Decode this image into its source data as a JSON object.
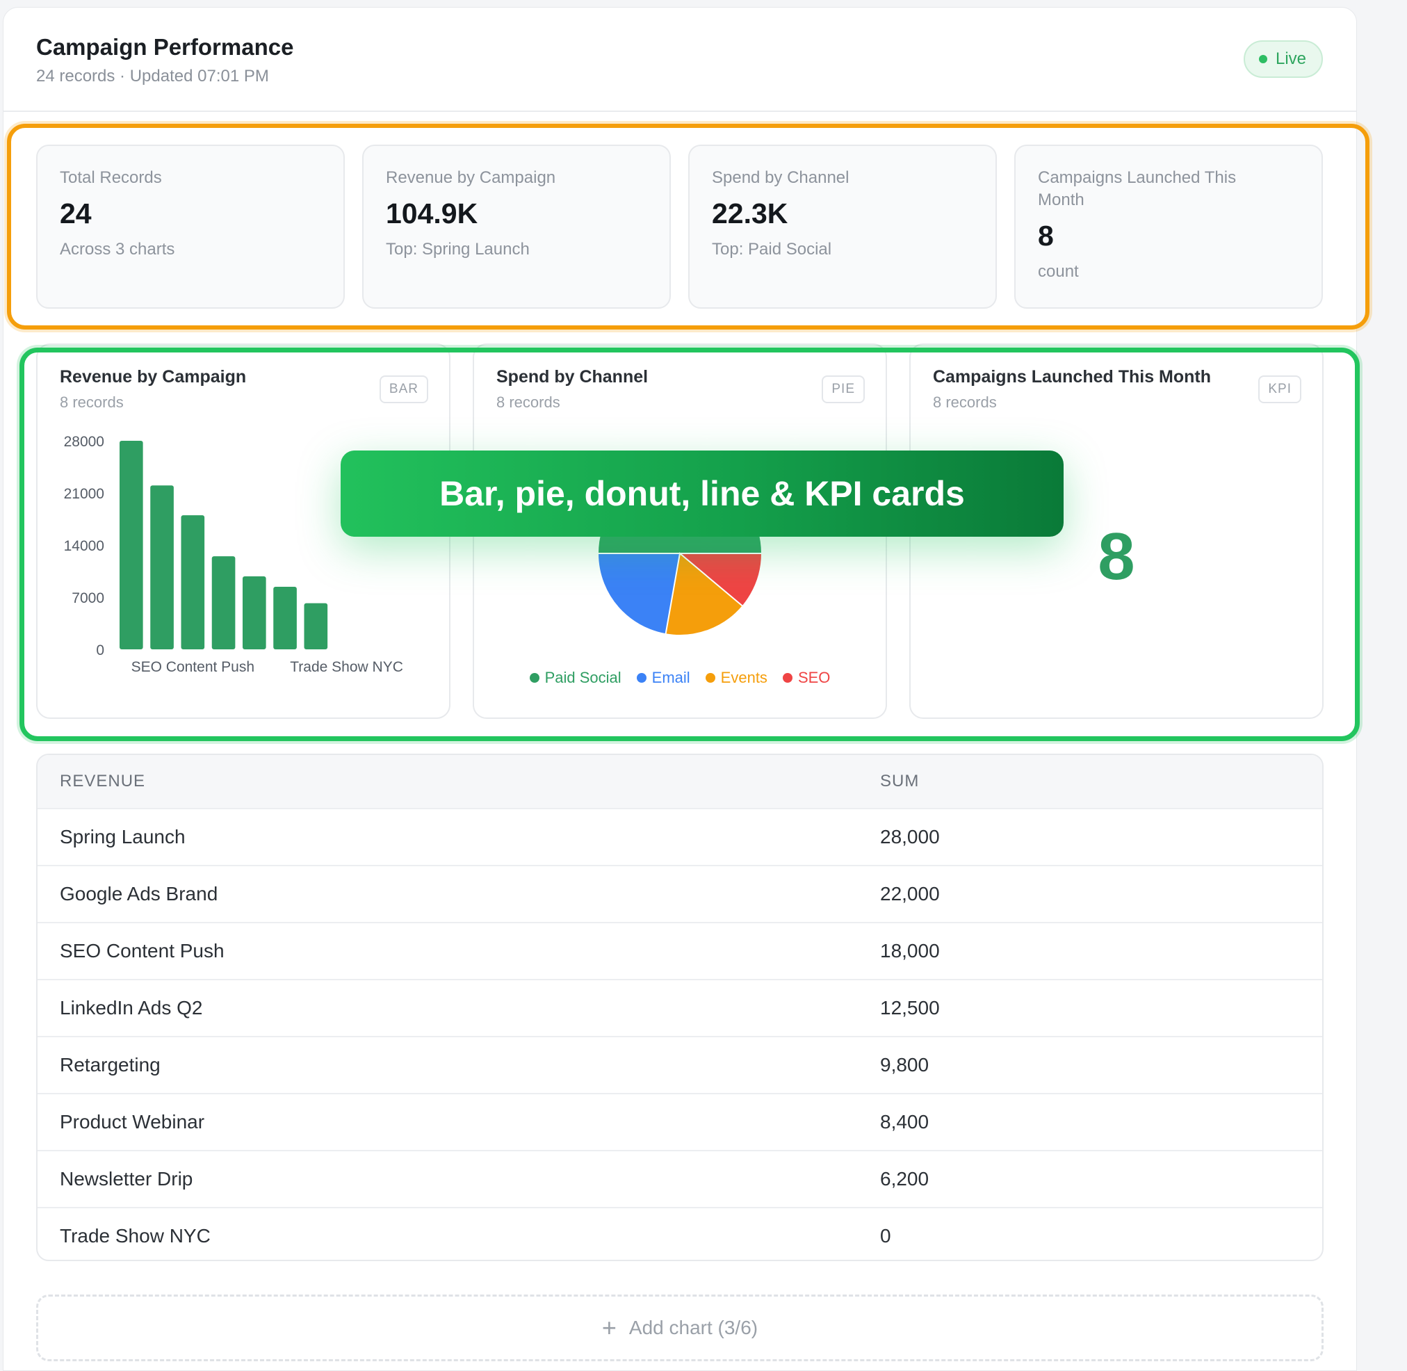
{
  "header": {
    "title": "Campaign Performance",
    "subtitle": "24 records · Updated 07:01 PM",
    "status": "Live"
  },
  "stats": [
    {
      "label": "Total Records",
      "value": "24",
      "sub": "Across 3 charts"
    },
    {
      "label": "Revenue by Campaign",
      "value": "104.9K",
      "sub": "Top: Spring Launch"
    },
    {
      "label": "Spend by Channel",
      "value": "22.3K",
      "sub": "Top: Paid Social"
    },
    {
      "label": "Campaigns Launched This Month",
      "value": "8",
      "sub": "count"
    }
  ],
  "charts": [
    {
      "title": "Revenue by Campaign",
      "records": "8 records",
      "tag": "BAR"
    },
    {
      "title": "Spend by Channel",
      "records": "8 records",
      "tag": "PIE"
    },
    {
      "title": "Campaigns Launched This Month",
      "records": "8 records",
      "tag": "KPI",
      "value": "8"
    }
  ],
  "banner": "Bar, pie, donut, line & KPI cards",
  "chart_data": [
    {
      "type": "bar",
      "title": "Revenue by Campaign",
      "categories": [
        "Spring Launch",
        "Google Ads Brand",
        "SEO Content Push",
        "LinkedIn Ads Q2",
        "Retargeting",
        "Product Webinar",
        "Newsletter Drip",
        "Trade Show NYC"
      ],
      "x_tick_labels": [
        "SEO Content Push",
        "Trade Show NYC"
      ],
      "values": [
        28000,
        22000,
        18000,
        12500,
        9800,
        8400,
        6200,
        0
      ],
      "y_ticks": [
        28000,
        21000,
        14000,
        7000,
        0
      ],
      "ylim": [
        0,
        28000
      ],
      "color": "#2f9e62"
    },
    {
      "type": "pie",
      "title": "Spend by Channel",
      "legend": [
        {
          "name": "Paid Social",
          "color": "#2f9e62"
        },
        {
          "name": "Email",
          "color": "#3b82f6"
        },
        {
          "name": "Events",
          "color": "#f59e0b"
        },
        {
          "name": "SEO",
          "color": "#ef4444"
        }
      ]
    }
  ],
  "table": {
    "columns": [
      "REVENUE",
      "SUM"
    ],
    "rows": [
      [
        "Spring Launch",
        "28,000"
      ],
      [
        "Google Ads Brand",
        "22,000"
      ],
      [
        "SEO Content Push",
        "18,000"
      ],
      [
        "LinkedIn Ads Q2",
        "12,500"
      ],
      [
        "Retargeting",
        "9,800"
      ],
      [
        "Product Webinar",
        "8,400"
      ],
      [
        "Newsletter Drip",
        "6,200"
      ],
      [
        "Trade Show NYC",
        "0"
      ]
    ]
  },
  "add_chart": "Add chart (3/6)"
}
